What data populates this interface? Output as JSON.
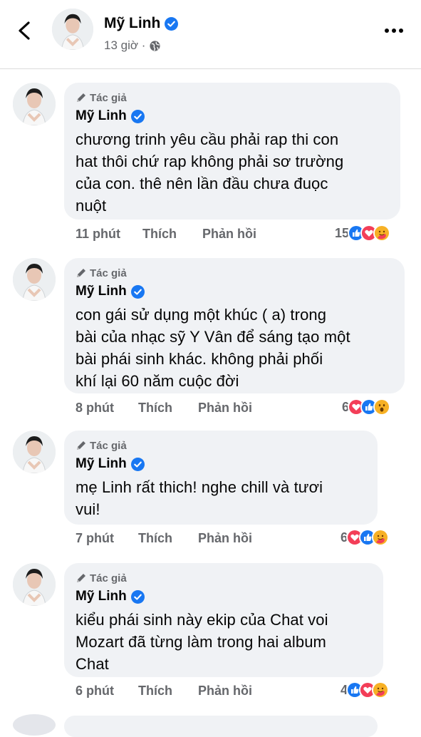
{
  "header": {
    "name": "Mỹ Linh",
    "time": "13 giờ ·",
    "back_icon": "chevron-left-icon",
    "more_icon": "more-horizontal-icon",
    "privacy_icon": "globe-icon"
  },
  "colors": {
    "verified": "#1877f2",
    "bubble": "#f0f2f5",
    "meta": "#65676b",
    "like": "#1877f2",
    "love": "#f33e58",
    "care": "#f7b125"
  },
  "comments": [
    {
      "badge": "Tác giả",
      "author": "Mỹ Linh",
      "text_lines": [
        "chương trinh yêu cầu phải rap thi con",
        "hat thôi chứ rap không phải sơ trường",
        "của con. thê nên lần đầu chưa đuọc",
        "nuột"
      ],
      "time": "11 phút",
      "like": "Thích",
      "reply": "Phản hồi",
      "reaction_count": "15",
      "reactions": [
        "like",
        "love",
        "care"
      ]
    },
    {
      "badge": "Tác giả",
      "author": "Mỹ Linh",
      "text_lines": [
        "con gái sử dụng một khúc ( a) trong",
        "bài của nhạc sỹ Y Vân để sáng tạo một",
        "bài phái sinh khác. không phải phối",
        "khí lại 60 năm cuộc đời"
      ],
      "time": "8 phút",
      "like": "Thích",
      "reply": "Phản hồi",
      "reaction_count": "6",
      "reactions": [
        "love",
        "like",
        "wow"
      ]
    },
    {
      "badge": "Tác giả",
      "author": "Mỹ Linh",
      "text_lines": [
        "mẹ Linh rất thich! nghe chill và tươi",
        "vui!"
      ],
      "time": "7 phút",
      "like": "Thích",
      "reply": "Phản hồi",
      "reaction_count": "6",
      "reactions": [
        "love",
        "like",
        "care"
      ]
    },
    {
      "badge": "Tác giả",
      "author": "Mỹ Linh",
      "text_lines": [
        "kiểu phái sinh này ekip của Chat voi",
        "Mozart đã từng làm trong hai album",
        "Chat"
      ],
      "time": "6 phút",
      "like": "Thích",
      "reply": "Phản hồi",
      "reaction_count": "4",
      "reactions": [
        "like",
        "love",
        "care"
      ]
    }
  ]
}
